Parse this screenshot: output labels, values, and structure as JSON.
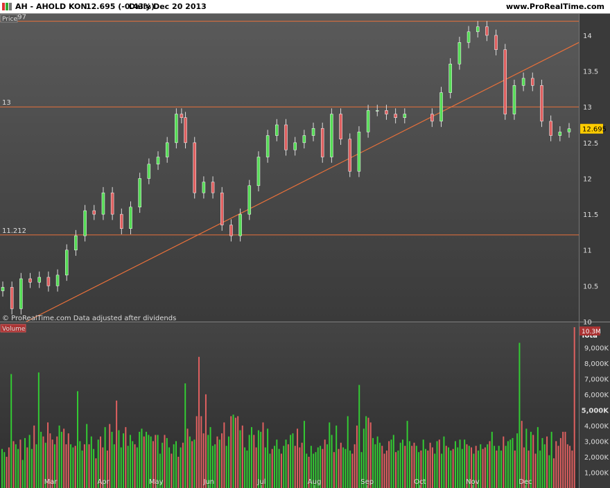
{
  "header": {
    "title": "AH - AHOLD KON",
    "last_price": "12.695 (-0.43%)",
    "period": "Daily  Dec 20 2013",
    "site": "www.ProRealTime.com"
  },
  "price_panel": {
    "label": "Price",
    "current_price": "12.695",
    "current_price_bg": "#ffcc00",
    "footer": "© ProRealTime.com  Data adjusted after dividends",
    "hlines": [
      {
        "label": "14.197",
        "value": 14.197
      },
      {
        "label": "13",
        "value": 13
      },
      {
        "label": "11.212",
        "value": 11.212
      }
    ],
    "trendline": {
      "start": {
        "date": "Mar 1 2013",
        "price": 10.0
      },
      "end": {
        "date": "Dec 20 2013",
        "price": 13.9
      }
    },
    "line_color": "#e8703a"
  },
  "volume_panel": {
    "label": "Volume",
    "current_volume": "10.3M",
    "total_label": "Tota",
    "up_color": "#33cc33",
    "down_color": "#e06060"
  },
  "chart_data": [
    {
      "type": "candlestick",
      "title": "AH - AHOLD KON",
      "period": "Daily",
      "ylim": [
        10,
        14.3
      ],
      "yticks": [
        "10",
        "10.5",
        "11",
        "11.5",
        "12",
        "12.5",
        "13",
        "13.5",
        "14"
      ],
      "xticks": [
        "Mar",
        "Apr",
        "May",
        "Jun",
        "Jul",
        "Aug",
        "Sep",
        "Oct",
        "Nov",
        "Dec"
      ],
      "series": [
        {
          "x": "2013-02-11",
          "close": 10.48
        },
        {
          "x": "2013-02-18",
          "close": 10.18
        },
        {
          "x": "2013-02-25",
          "close": 10.6
        },
        {
          "x": "2013-03-04",
          "close": 10.55
        },
        {
          "x": "2013-03-11",
          "close": 10.62
        },
        {
          "x": "2013-03-18",
          "close": 10.5
        },
        {
          "x": "2013-03-25",
          "close": 10.65
        },
        {
          "x": "2013-04-01",
          "close": 11.0
        },
        {
          "x": "2013-04-08",
          "close": 11.2
        },
        {
          "x": "2013-04-15",
          "close": 11.55
        },
        {
          "x": "2013-04-22",
          "close": 11.5
        },
        {
          "x": "2013-04-29",
          "close": 11.8
        },
        {
          "x": "2013-05-06",
          "close": 11.5
        },
        {
          "x": "2013-05-13",
          "close": 11.3
        },
        {
          "x": "2013-05-20",
          "close": 11.6
        },
        {
          "x": "2013-05-27",
          "close": 12.0
        },
        {
          "x": "2013-06-03",
          "close": 12.2
        },
        {
          "x": "2013-06-10",
          "close": 12.3
        },
        {
          "x": "2013-06-17",
          "close": 12.5
        },
        {
          "x": "2013-06-24",
          "close": 12.9
        },
        {
          "x": "2013-06-28",
          "close": 12.85
        },
        {
          "x": "2013-07-01",
          "close": 12.5
        },
        {
          "x": "2013-07-08",
          "close": 11.8
        },
        {
          "x": "2013-07-15",
          "close": 11.95
        },
        {
          "x": "2013-07-22",
          "close": 11.8
        },
        {
          "x": "2013-07-29",
          "close": 11.35
        },
        {
          "x": "2013-08-05",
          "close": 11.2
        },
        {
          "x": "2013-08-12",
          "close": 11.5
        },
        {
          "x": "2013-08-19",
          "close": 11.9
        },
        {
          "x": "2013-08-26",
          "close": 12.3
        },
        {
          "x": "2013-09-02",
          "close": 12.6
        },
        {
          "x": "2013-09-09",
          "close": 12.75
        },
        {
          "x": "2013-09-16",
          "close": 12.4
        },
        {
          "x": "2013-09-23",
          "close": 12.5
        },
        {
          "x": "2013-09-30",
          "close": 12.6
        },
        {
          "x": "2013-10-07",
          "close": 12.7
        },
        {
          "x": "2013-10-14",
          "close": 12.3
        },
        {
          "x": "2013-10-21",
          "close": 12.9
        },
        {
          "x": "2013-10-28",
          "close": 12.55
        },
        {
          "x": "2013-11-04",
          "close": 12.1
        },
        {
          "x": "2013-11-11",
          "close": 12.65
        },
        {
          "x": "2013-11-18",
          "close": 12.95
        },
        {
          "x": "2013-11-25",
          "close": 12.95
        },
        {
          "x": "2013-12-02",
          "close": 12.9
        },
        {
          "x": "2013-12-09",
          "close": 12.85
        },
        {
          "x": "2013-12-16",
          "close": 12.9
        },
        {
          "x": "2014-01-06",
          "close": 12.8
        },
        {
          "x": "2014-01-13",
          "close": 13.2
        },
        {
          "x": "2014-01-20",
          "close": 13.6
        },
        {
          "x": "2014-01-27",
          "close": 13.9
        },
        {
          "x": "2014-02-03",
          "close": 14.05
        },
        {
          "x": "2014-02-10",
          "close": 14.12
        },
        {
          "x": "2014-02-17",
          "close": 14.0
        },
        {
          "x": "2014-02-24",
          "close": 13.8
        },
        {
          "x": "2014-03-03",
          "close": 12.9
        },
        {
          "x": "2014-03-10",
          "close": 13.3
        },
        {
          "x": "2014-03-17",
          "close": 13.4
        },
        {
          "x": "2014-03-24",
          "close": 13.3
        },
        {
          "x": "2014-03-31",
          "close": 12.8
        },
        {
          "x": "2014-04-07",
          "close": 12.6
        },
        {
          "x": "2014-04-14",
          "close": 12.65
        },
        {
          "x": "2014-04-21",
          "close": 12.695
        }
      ]
    },
    {
      "type": "bar",
      "title": "Volume",
      "yticks": [
        "1,000K",
        "2,000K",
        "3,000K",
        "4,000K",
        "5,000K",
        "6,000K",
        "7,000K",
        "8,000K",
        "9,000K"
      ],
      "highlight_labels": [
        "5,000K"
      ],
      "ylim": [
        0,
        10300000
      ],
      "values": [
        2500000,
        2300000,
        2000000,
        2600000,
        7300000,
        3000000,
        2800000,
        2500000,
        3100000,
        1800000,
        3200000,
        2600000,
        3400000,
        2500000,
        4000000,
        2800000,
        7400000,
        3600000,
        3300000,
        2900000,
        4200000,
        3500000,
        3100000,
        2800000,
        3300000,
        4000000,
        3600000,
        3800000,
        2800000,
        3500000,
        2800000,
        2600000,
        2700000,
        6200000,
        3000000,
        2400000,
        2800000,
        4100000,
        2800000,
        3300000,
        2500000,
        1900000,
        3100000,
        3300000,
        2600000,
        3900000,
        2400000,
        4100000,
        3600000,
        2800000,
        5600000,
        3700000,
        2600000,
        3500000,
        3900000,
        2700000,
        3400000,
        3000000,
        2800000,
        2600000,
        3600000,
        3800000,
        3300000,
        3600000,
        3400000,
        3300000,
        3000000,
        3400000,
        3400000,
        2200000,
        2900000,
        3400000,
        3200000,
        2600000,
        2200000,
        2800000,
        3000000,
        2000000,
        2600000,
        2900000,
        6700000,
        3800000,
        3300000,
        3000000,
        3100000,
        4600000,
        8400000,
        4600000,
        3500000,
        6000000,
        3400000,
        3900000,
        2700000,
        2800000,
        3300000,
        3100000,
        3500000,
        4200000,
        2700000,
        3300000,
        4600000,
        4700000,
        4500000,
        4600000,
        3700000,
        4000000,
        2600000,
        2400000,
        3400000,
        3900000,
        3400000,
        2600000,
        3700000,
        3600000,
        4200000,
        2600000,
        3800000,
        2200000,
        2500000,
        2700000,
        3100000,
        2500000,
        2200000,
        2700000,
        3100000,
        2800000,
        3400000,
        3500000,
        2700000,
        3800000,
        2600000,
        2900000,
        4300000,
        2200000,
        2000000,
        2700000,
        2200000,
        2300000,
        2600000,
        2700000,
        2500000,
        3100000,
        2800000,
        4200000,
        3400000,
        2300000,
        4000000,
        2500000,
        2900000,
        2600000,
        2500000,
        4600000,
        2400000,
        2200000,
        2800000,
        4000000,
        6600000,
        2300000,
        3800000,
        4600000,
        4500000,
        4200000,
        3200000,
        2800000,
        3300000,
        2900000,
        2700000,
        2200000,
        2400000,
        3000000,
        3100000,
        3400000,
        2300000,
        2400000,
        2900000,
        3100000,
        2700000,
        4300000,
        3000000,
        2700000,
        2900000,
        2700000,
        2300000,
        2400000,
        3100000,
        2500000,
        2400000,
        2900000,
        2600000,
        2200000,
        3000000,
        3100000,
        2200000,
        3300000,
        2700000,
        2600000,
        2400000,
        2500000,
        3000000,
        2600000,
        3100000,
        2500000,
        3100000,
        2800000,
        2700000,
        2600000,
        2200000,
        2700000,
        2400000,
        2800000,
        2500000,
        2600000,
        2800000,
        3000000,
        3600000,
        2700000,
        2400000,
        2700000,
        2400000,
        3300000,
        2700000,
        3000000,
        3100000,
        3200000,
        2400000,
        3500000,
        9300000,
        4300000,
        2600000,
        3800000,
        2400000,
        3600000,
        3400000,
        2200000,
        3900000,
        2400000,
        3200000,
        2800000,
        3300000,
        2100000,
        3600000,
        1900000,
        3000000,
        2700000,
        3200000,
        3600000,
        3600000,
        2800000,
        2700000,
        2400000,
        10300000
      ],
      "up": [
        1,
        1,
        0,
        0,
        1,
        0,
        1,
        1,
        0,
        1,
        1,
        0,
        1,
        1,
        0,
        1,
        1,
        1,
        0,
        1,
        0,
        0,
        0,
        1,
        0,
        1,
        1,
        0,
        0,
        0,
        1,
        1,
        0,
        1,
        1,
        1,
        0,
        1,
        0,
        1,
        1,
        0,
        1,
        0,
        0,
        1,
        0,
        0,
        1,
        1,
        0,
        1,
        1,
        1,
        0,
        1,
        1,
        1,
        0,
        1,
        1,
        1,
        0,
        1,
        1,
        1,
        0,
        0,
        1,
        1,
        1,
        0,
        1,
        1,
        0,
        1,
        1,
        0,
        1,
        0,
        1,
        0,
        1,
        0,
        1,
        0,
        0,
        0,
        0,
        0,
        1,
        1,
        1,
        1,
        0,
        1,
        0,
        0,
        1,
        1,
        0,
        1,
        0,
        0,
        1,
        0,
        1,
        1,
        1,
        1,
        0,
        0,
        1,
        1,
        0,
        1,
        1,
        1,
        0,
        1,
        1,
        1,
        0,
        1,
        1,
        0,
        1,
        1,
        0,
        0,
        0,
        0,
        1,
        1,
        0,
        1,
        1,
        1,
        1,
        1,
        0,
        0,
        1,
        1,
        1,
        0,
        1,
        0,
        0,
        1,
        1,
        1,
        1,
        0,
        0,
        0,
        1,
        1,
        1,
        1,
        0,
        0,
        1,
        1,
        1,
        1,
        0,
        0,
        0,
        0,
        1,
        1,
        0,
        1,
        1,
        1,
        0,
        1,
        1,
        0,
        0,
        1,
        1,
        0,
        1,
        1,
        0,
        0,
        0,
        1,
        1,
        0,
        1,
        1,
        0,
        1,
        1,
        0,
        1,
        1,
        1,
        1,
        1,
        0,
        1,
        0,
        1,
        0,
        1,
        1,
        0,
        0,
        1,
        0,
        1,
        1,
        0,
        1,
        1,
        0,
        1,
        1,
        1,
        1,
        0,
        1,
        1,
        0,
        0,
        1,
        0,
        1,
        0,
        0,
        1,
        1,
        1,
        1,
        0,
        1,
        1,
        0
      ]
    }
  ]
}
